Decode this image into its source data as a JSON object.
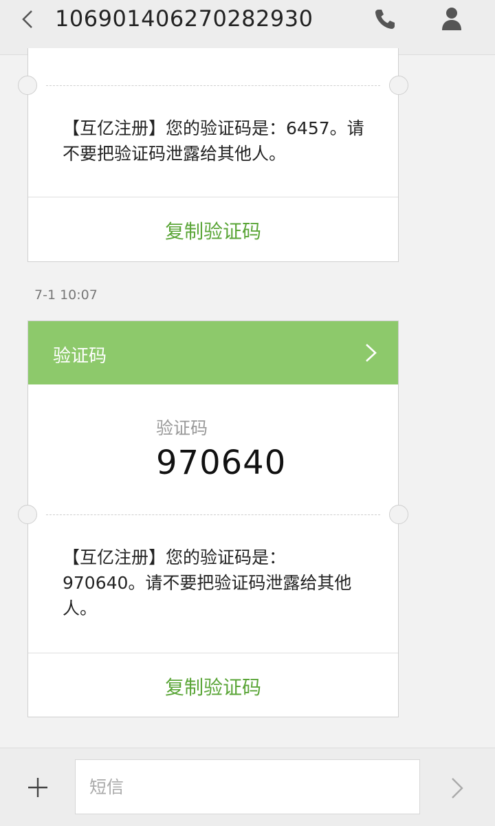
{
  "header": {
    "title": "106901406270282930",
    "back_icon": "chevron-left-icon",
    "call_icon": "phone-icon",
    "contact_icon": "person-icon"
  },
  "messages": [
    {
      "text": "【互亿注册】您的验证码是：6457。请不要把验证码泄露给其他人。",
      "copy_label": "复制验证码"
    },
    {
      "timestamp": "7-1 10:07",
      "header_title": "验证码",
      "code_label": "验证码",
      "code_value": "970640",
      "text": "【互亿注册】您的验证码是：970640。请不要把验证码泄露给其他人。",
      "copy_label": "复制验证码"
    }
  ],
  "composer": {
    "placeholder": "短信",
    "add_icon": "plus-icon",
    "send_icon": "chevron-right-icon"
  },
  "colors": {
    "accent_green": "#5aa537",
    "header_green": "#8dc96b",
    "background": "#f2f2f2"
  }
}
